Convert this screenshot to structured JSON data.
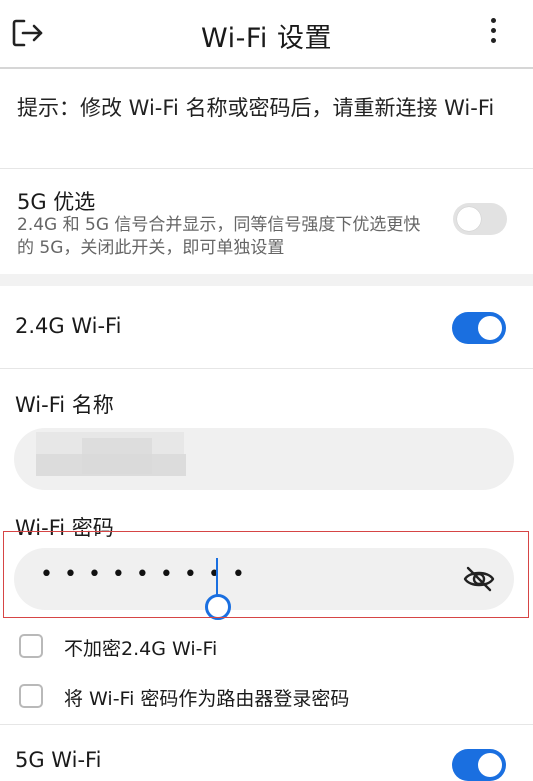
{
  "header": {
    "title": "Wi-Fi 设置",
    "back_icon": "exit-arrow-icon",
    "more_icon": "more-vertical-icon"
  },
  "tip": {
    "text": "提示：修改 Wi-Fi 名称或密码后，请重新连接 Wi-Fi"
  },
  "prefer_5g": {
    "title": "5G 优选",
    "description": "2.4G 和 5G 信号合并显示，同等信号强度下优选更快的 5G，关闭此开关，即可单独设置",
    "enabled": false
  },
  "wifi_24g": {
    "title": "2.4G Wi-Fi",
    "enabled": true,
    "name_label": "Wi-Fi 名称",
    "name_value": "",
    "password_label": "Wi-Fi 密码",
    "password_masked": "•••••••••",
    "eye_icon": "eye-off-icon",
    "options": [
      {
        "label": "不加密2.4G Wi-Fi",
        "checked": false
      },
      {
        "label": "将 Wi-Fi 密码作为路由器登录密码",
        "checked": false
      }
    ]
  },
  "wifi_5g": {
    "title": "5G Wi-Fi",
    "enabled": true
  },
  "colors": {
    "accent": "#1a6fe0",
    "highlight_border": "#d64545",
    "field_bg": "#f0f0f0"
  }
}
